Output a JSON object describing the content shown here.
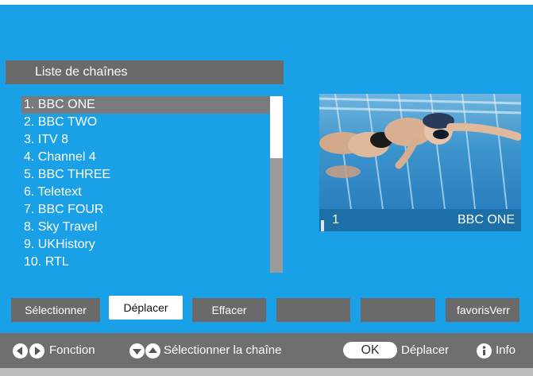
{
  "title": "Liste de chaînes",
  "channels": [
    "1. BBC ONE",
    "2. BBC TWO",
    "3. ITV 8",
    "4. Channel 4",
    "5. BBC THREE",
    "6. Teletext",
    "7. BBC FOUR",
    "8. Sky Travel",
    "9. UKHistory",
    "10. RTL"
  ],
  "preview": {
    "number": "1",
    "name": "BBC ONE"
  },
  "buttons": [
    "Sélectionner",
    "Déplacer",
    "Effacer",
    "",
    "",
    "favorisVerr"
  ],
  "footer": {
    "fonction": "Fonction",
    "select_channel": "Sélectionner la chaîne",
    "ok": "OK",
    "deplacer": "Déplacer",
    "info": "Info"
  },
  "icons": [
    "left-arrow-icon",
    "right-arrow-icon",
    "down-arrow-icon",
    "up-arrow-icon",
    "info-icon"
  ],
  "colors": {
    "background": "#1aa0e6",
    "panel": "#6a6a6a",
    "selected": "#7a7a7a"
  }
}
